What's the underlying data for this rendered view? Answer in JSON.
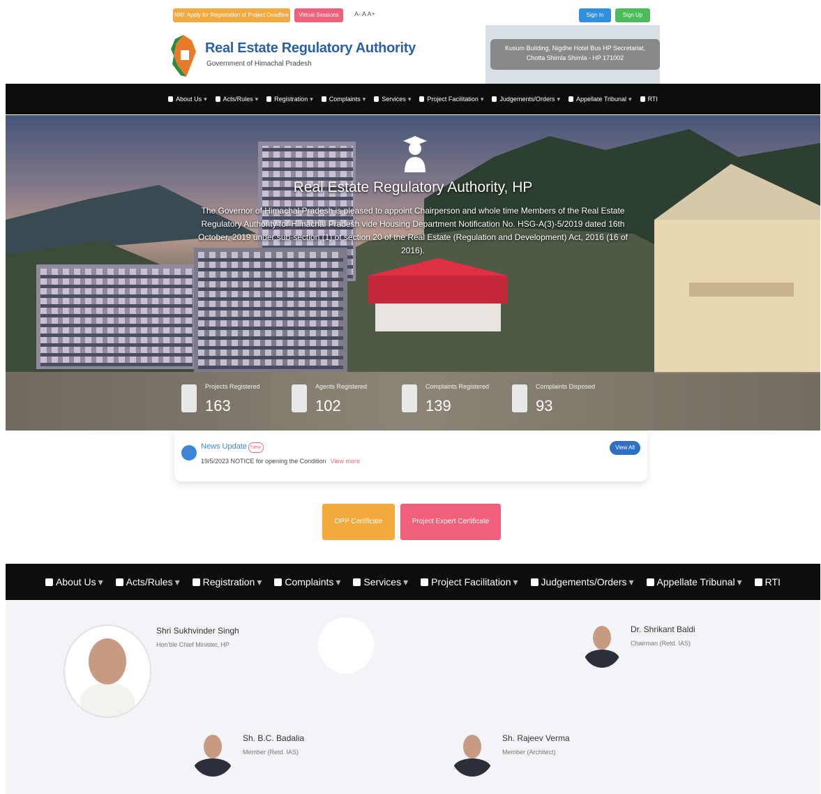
{
  "top_bar": {
    "notice_button": "NRI: Apply for Registration of Project Deadline",
    "red_button": "Virtual Sessions",
    "text_size_controls": "A- A A+",
    "signin_button": "Sign In",
    "signup_button": "Sign Up"
  },
  "brand": {
    "title": "Real Estate Regulatory Authority",
    "subtitle": "Government of Himachal Pradesh"
  },
  "address": {
    "line1": "Kusum Building, Nigdhe Hotel Bus HP Secretariat,",
    "line2": "Chotta Shimla Shimla - HP 171002"
  },
  "nav": [
    {
      "label": "About Us",
      "caret": true
    },
    {
      "label": "Acts/Rules",
      "caret": true
    },
    {
      "label": "Registration",
      "caret": true
    },
    {
      "label": "Complaints",
      "caret": true
    },
    {
      "label": "Services",
      "caret": true
    },
    {
      "label": "Project Facilitation",
      "caret": true
    },
    {
      "label": "Judgements/Orders",
      "caret": true
    },
    {
      "label": "Appellate Tribunal",
      "caret": true
    },
    {
      "label": "RTI",
      "caret": false
    }
  ],
  "hero": {
    "title": "Real Estate Regulatory Authority, HP",
    "description": "The Governor of Himachal Pradesh is pleased to appoint Chairperson and whole time Members of the Real Estate Regulatory Authority for Himachal Pradesh vide Housing Department Notification No. HSG-A(3)-5/2019 dated 16th October, 2019 under sub-section (1) of section 20 of the Real Estate (Regulation and Development) Act, 2016 (16 of 2016)."
  },
  "stats": [
    {
      "label": "Projects Registered",
      "value": "163"
    },
    {
      "label": "Agents Registered",
      "value": "102"
    },
    {
      "label": "Complaints Registered",
      "value": "139"
    },
    {
      "label": "Complaints Disposed",
      "value": "93"
    }
  ],
  "news": {
    "title": "News Update",
    "badge": "New",
    "text": "19/5/2023 NOTICE for opening the Condition",
    "more": "View more",
    "view_all": "View All"
  },
  "certificates": {
    "cert1": "OPP Certificate",
    "cert2": "Project Expert Certificate"
  },
  "people": [
    {
      "name": "Shri Sukhvinder Singh",
      "role": "Hon'ble Chief Minister, HP"
    },
    {
      "name": "Dr. Shrikant Baldi",
      "role": "Chairman (Retd. IAS)"
    },
    {
      "name": "Sh. B.C. Badalia",
      "role": "Member (Retd. IAS)"
    },
    {
      "name": "Sh. Rajeev Verma",
      "role": "Member (Architect)"
    }
  ],
  "colors": {
    "brand_blue": "#2b5fa8",
    "nav_bg": "#0d0d0d",
    "orange": "#f3a93b",
    "pink": "#f0607a",
    "blue_btn": "#2f8fe0",
    "green_btn": "#4cbb5a"
  }
}
